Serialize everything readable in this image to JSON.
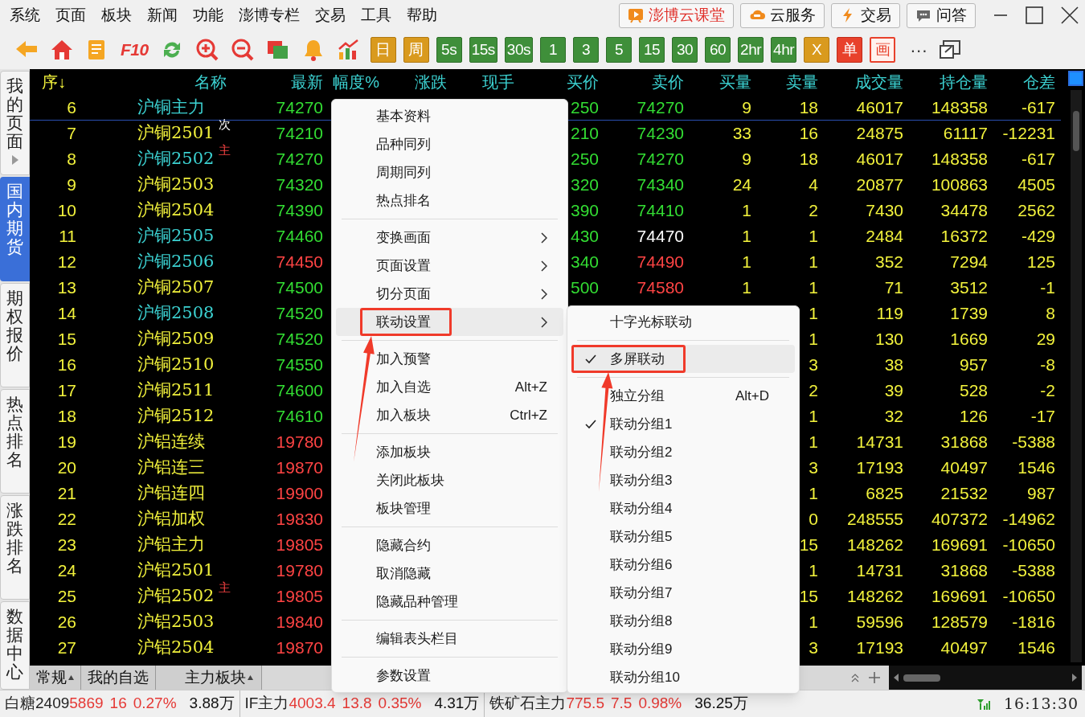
{
  "menu_bar": [
    "系统",
    "页面",
    "板块",
    "新闻",
    "功能",
    "澎博专栏",
    "交易",
    "工具",
    "帮助"
  ],
  "top_buttons": [
    {
      "label": "澎博云课堂",
      "kind": "course"
    },
    {
      "label": "云服务",
      "kind": "cloud"
    },
    {
      "label": "交易",
      "kind": "trade"
    },
    {
      "label": "问答",
      "kind": "qa"
    }
  ],
  "toolbar": {
    "f10_label": "F10",
    "period_buttons": [
      {
        "label": "日",
        "kind": "orange"
      },
      {
        "label": "周",
        "kind": "orange"
      },
      {
        "label": "5s",
        "kind": "green"
      },
      {
        "label": "15s",
        "kind": "green"
      },
      {
        "label": "30s",
        "kind": "green"
      },
      {
        "label": "1",
        "kind": "green"
      },
      {
        "label": "3",
        "kind": "green"
      },
      {
        "label": "5",
        "kind": "green"
      },
      {
        "label": "15",
        "kind": "green"
      },
      {
        "label": "30",
        "kind": "green"
      },
      {
        "label": "60",
        "kind": "green"
      },
      {
        "label": "2hr",
        "kind": "green"
      },
      {
        "label": "4hr",
        "kind": "green"
      },
      {
        "label": "X",
        "kind": "orange"
      },
      {
        "label": "单",
        "kind": "red"
      },
      {
        "label": "画",
        "kind": "outline"
      }
    ],
    "more_label": "···"
  },
  "side_tabs": [
    {
      "label": "我的页面",
      "selected": false,
      "arrow": true
    },
    {
      "label": "国内期货",
      "selected": true,
      "arrow": false
    },
    {
      "label": "期权报价",
      "selected": false,
      "arrow": false
    },
    {
      "label": "热点排名",
      "selected": false,
      "arrow": false
    },
    {
      "label": "涨跌排名",
      "selected": false,
      "arrow": false
    },
    {
      "label": "数据中心",
      "selected": false,
      "arrow": false
    }
  ],
  "table": {
    "columns": [
      "序↓",
      "名称",
      "最新",
      "幅度%",
      "涨跌",
      "现手",
      "买价",
      "卖价",
      "买量",
      "卖量",
      "成交量",
      "持仓量",
      "仓差"
    ],
    "rows": [
      {
        "seq": "6",
        "name": {
          "text": "沪铜主力",
          "color": "#3cd2d2"
        },
        "last": {
          "text": "74270",
          "color": "#33dd33"
        },
        "bid": {
          "text": "250",
          "color": "#33dd33"
        },
        "ask": {
          "text": "74270",
          "color": "#33dd33"
        },
        "bid_vol": "9",
        "ask_vol": "18",
        "volume": "46017",
        "open_interest": "148358",
        "oi_change": "-617"
      },
      {
        "seq": "7",
        "name": {
          "text": "沪铜2501",
          "color": "#f2f23c"
        },
        "tag": {
          "text": "次",
          "color": "#ffffff"
        },
        "last": {
          "text": "74210",
          "color": "#33dd33"
        },
        "bid": {
          "text": "210",
          "color": "#33dd33"
        },
        "ask": {
          "text": "74230",
          "color": "#33dd33"
        },
        "bid_vol": "33",
        "ask_vol": "16",
        "volume": "24875",
        "open_interest": "61117",
        "oi_change": "-12231"
      },
      {
        "seq": "8",
        "name": {
          "text": "沪铜2502",
          "color": "#3cd2d2"
        },
        "tag": {
          "text": "主",
          "color": "#ff4444"
        },
        "last": {
          "text": "74270",
          "color": "#33dd33"
        },
        "bid": {
          "text": "250",
          "color": "#33dd33"
        },
        "ask": {
          "text": "74270",
          "color": "#33dd33"
        },
        "bid_vol": "9",
        "ask_vol": "18",
        "volume": "46017",
        "open_interest": "148358",
        "oi_change": "-617"
      },
      {
        "seq": "9",
        "name": {
          "text": "沪铜2503",
          "color": "#f2f23c"
        },
        "last": {
          "text": "74320",
          "color": "#33dd33"
        },
        "bid": {
          "text": "320",
          "color": "#33dd33"
        },
        "ask": {
          "text": "74340",
          "color": "#33dd33"
        },
        "bid_vol": "24",
        "ask_vol": "4",
        "volume": "20877",
        "open_interest": "100863",
        "oi_change": "4505"
      },
      {
        "seq": "10",
        "name": {
          "text": "沪铜2504",
          "color": "#f2f23c"
        },
        "last": {
          "text": "74390",
          "color": "#33dd33"
        },
        "bid": {
          "text": "390",
          "color": "#33dd33"
        },
        "ask": {
          "text": "74410",
          "color": "#33dd33"
        },
        "bid_vol": "1",
        "ask_vol": "2",
        "volume": "7430",
        "open_interest": "34478",
        "oi_change": "2562"
      },
      {
        "seq": "11",
        "name": {
          "text": "沪铜2505",
          "color": "#3cd2d2"
        },
        "last": {
          "text": "74460",
          "color": "#33dd33"
        },
        "bid": {
          "text": "430",
          "color": "#33dd33"
        },
        "ask": {
          "text": "74470",
          "color": "#ffffff"
        },
        "bid_vol": "1",
        "ask_vol": "1",
        "volume": "2484",
        "open_interest": "16372",
        "oi_change": "-429"
      },
      {
        "seq": "12",
        "name": {
          "text": "沪铜2506",
          "color": "#3cd2d2"
        },
        "last": {
          "text": "74450",
          "color": "#ff4444"
        },
        "bid": {
          "text": "340",
          "color": "#33dd33"
        },
        "ask": {
          "text": "74490",
          "color": "#ff4444"
        },
        "bid_vol": "1",
        "ask_vol": "1",
        "volume": "352",
        "open_interest": "7294",
        "oi_change": "125"
      },
      {
        "seq": "13",
        "name": {
          "text": "沪铜2507",
          "color": "#f2f23c"
        },
        "last": {
          "text": "74500",
          "color": "#33dd33"
        },
        "bid": {
          "text": "500",
          "color": "#33dd33"
        },
        "ask": {
          "text": "74580",
          "color": "#ff4444"
        },
        "bid_vol": "1",
        "ask_vol": "1",
        "volume": "71",
        "open_interest": "3512",
        "oi_change": "-1"
      },
      {
        "seq": "14",
        "name": {
          "text": "沪铜2508",
          "color": "#3cd2d2"
        },
        "last": {
          "text": "74520",
          "color": "#33dd33"
        },
        "ask_vol": "1",
        "volume": "119",
        "open_interest": "1739",
        "oi_change": "8"
      },
      {
        "seq": "15",
        "name": {
          "text": "沪铜2509",
          "color": "#f2f23c"
        },
        "last": {
          "text": "74520",
          "color": "#33dd33"
        },
        "ask_vol": "1",
        "volume": "130",
        "open_interest": "1669",
        "oi_change": "29"
      },
      {
        "seq": "16",
        "name": {
          "text": "沪铜2510",
          "color": "#f2f23c"
        },
        "last": {
          "text": "74550",
          "color": "#33dd33"
        },
        "ask_vol": "3",
        "volume": "38",
        "open_interest": "957",
        "oi_change": "-8"
      },
      {
        "seq": "17",
        "name": {
          "text": "沪铜2511",
          "color": "#f2f23c"
        },
        "last": {
          "text": "74600",
          "color": "#33dd33"
        },
        "ask_vol": "2",
        "volume": "39",
        "open_interest": "528",
        "oi_change": "-2"
      },
      {
        "seq": "18",
        "name": {
          "text": "沪铜2512",
          "color": "#f2f23c"
        },
        "last": {
          "text": "74610",
          "color": "#33dd33"
        },
        "ask_vol": "1",
        "volume": "32",
        "open_interest": "126",
        "oi_change": "-17"
      },
      {
        "seq": "19",
        "name": {
          "text": "沪铝连续",
          "color": "#f2f23c"
        },
        "last": {
          "text": "19780",
          "color": "#ff4444"
        },
        "ask_vol": "1",
        "volume": "14731",
        "open_interest": "31868",
        "oi_change": "-5388"
      },
      {
        "seq": "20",
        "name": {
          "text": "沪铝连三",
          "color": "#f2f23c"
        },
        "last": {
          "text": "19870",
          "color": "#ff4444"
        },
        "ask_vol": "3",
        "volume": "17193",
        "open_interest": "40497",
        "oi_change": "1546"
      },
      {
        "seq": "21",
        "name": {
          "text": "沪铝连四",
          "color": "#f2f23c"
        },
        "last": {
          "text": "19900",
          "color": "#ff4444"
        },
        "ask_vol": "1",
        "volume": "6825",
        "open_interest": "21532",
        "oi_change": "987"
      },
      {
        "seq": "22",
        "name": {
          "text": "沪铝加权",
          "color": "#f2f23c"
        },
        "last": {
          "text": "19830",
          "color": "#ff4444"
        },
        "ask_vol": "0",
        "volume": "248555",
        "open_interest": "407372",
        "oi_change": "-14962"
      },
      {
        "seq": "23",
        "name": {
          "text": "沪铝主力",
          "color": "#f2f23c"
        },
        "last": {
          "text": "19805",
          "color": "#ff4444"
        },
        "ask_vol": "15",
        "volume": "148262",
        "open_interest": "169691",
        "oi_change": "-10650"
      },
      {
        "seq": "24",
        "name": {
          "text": "沪铝2501",
          "color": "#f2f23c"
        },
        "last": {
          "text": "19780",
          "color": "#ff4444"
        },
        "ask_vol": "1",
        "volume": "14731",
        "open_interest": "31868",
        "oi_change": "-5388"
      },
      {
        "seq": "25",
        "name": {
          "text": "沪铝2502",
          "color": "#f2f23c"
        },
        "tag": {
          "text": "主",
          "color": "#ff4444"
        },
        "last": {
          "text": "19805",
          "color": "#ff4444"
        },
        "ask_vol": "15",
        "volume": "148262",
        "open_interest": "169691",
        "oi_change": "-10650"
      },
      {
        "seq": "26",
        "name": {
          "text": "沪铝2503",
          "color": "#f2f23c"
        },
        "last": {
          "text": "19840",
          "color": "#ff4444"
        },
        "ask_vol": "1",
        "volume": "59596",
        "open_interest": "128579",
        "oi_change": "-1816"
      },
      {
        "seq": "27",
        "name": {
          "text": "沪铝2504",
          "color": "#f2f23c"
        },
        "last": {
          "text": "19870",
          "color": "#ff4444"
        },
        "ask_vol": "3",
        "volume": "17193",
        "open_interest": "40497",
        "oi_change": "1546"
      }
    ]
  },
  "context_menu": [
    {
      "kind": "item",
      "label": "基本资料",
      "submenu": false,
      "selected": false,
      "annotated": false
    },
    {
      "kind": "item",
      "label": "品种同列",
      "submenu": false,
      "selected": false,
      "annotated": false
    },
    {
      "kind": "item",
      "label": "周期同列",
      "submenu": false,
      "selected": false,
      "annotated": false
    },
    {
      "kind": "item",
      "label": "热点排名",
      "submenu": false,
      "selected": false,
      "annotated": false
    },
    {
      "kind": "separator"
    },
    {
      "kind": "item",
      "label": "变换画面",
      "submenu": true,
      "selected": false,
      "annotated": false
    },
    {
      "kind": "item",
      "label": "页面设置",
      "submenu": true,
      "selected": false,
      "annotated": false
    },
    {
      "kind": "item",
      "label": "切分页面",
      "submenu": true,
      "selected": false,
      "annotated": false
    },
    {
      "kind": "item",
      "label": "联动设置",
      "submenu": true,
      "selected": true,
      "annotated": true
    },
    {
      "kind": "separator"
    },
    {
      "kind": "item",
      "label": "加入预警",
      "submenu": false,
      "selected": false,
      "annotated": false
    },
    {
      "kind": "item",
      "label": "加入自选",
      "shortcut": "Alt+Z",
      "submenu": false,
      "selected": false,
      "annotated": false
    },
    {
      "kind": "item",
      "label": "加入板块",
      "shortcut": "Ctrl+Z",
      "submenu": false,
      "selected": false,
      "annotated": false
    },
    {
      "kind": "separator"
    },
    {
      "kind": "item",
      "label": "添加板块",
      "submenu": false,
      "selected": false,
      "annotated": false
    },
    {
      "kind": "item",
      "label": "关闭此板块",
      "submenu": false,
      "selected": false,
      "annotated": false
    },
    {
      "kind": "item",
      "label": "板块管理",
      "submenu": false,
      "selected": false,
      "annotated": false
    },
    {
      "kind": "separator"
    },
    {
      "kind": "item",
      "label": "隐藏合约",
      "submenu": false,
      "selected": false,
      "annotated": false
    },
    {
      "kind": "item",
      "label": "取消隐藏",
      "submenu": false,
      "selected": false,
      "annotated": false
    },
    {
      "kind": "item",
      "label": "隐藏品种管理",
      "submenu": false,
      "selected": false,
      "annotated": false
    },
    {
      "kind": "separator"
    },
    {
      "kind": "item",
      "label": "编辑表头栏目",
      "submenu": false,
      "selected": false,
      "annotated": false
    },
    {
      "kind": "separator"
    },
    {
      "kind": "item",
      "label": "参数设置",
      "submenu": false,
      "selected": false,
      "annotated": false
    }
  ],
  "submenu": [
    {
      "kind": "item",
      "label": "十字光标联动",
      "checked": false,
      "selected": false,
      "annotated": false
    },
    {
      "kind": "separator"
    },
    {
      "kind": "item",
      "label": "多屏联动",
      "checked": true,
      "selected": true,
      "annotated": true
    },
    {
      "kind": "separator"
    },
    {
      "kind": "item",
      "label": "独立分组",
      "shortcut": "Alt+D",
      "checked": false,
      "selected": false,
      "annotated": false
    },
    {
      "kind": "item",
      "label": "联动分组1",
      "checked": true,
      "selected": false,
      "annotated": false
    },
    {
      "kind": "item",
      "label": "联动分组2",
      "checked": false,
      "selected": false,
      "annotated": false
    },
    {
      "kind": "item",
      "label": "联动分组3",
      "checked": false,
      "selected": false,
      "annotated": false
    },
    {
      "kind": "item",
      "label": "联动分组4",
      "checked": false,
      "selected": false,
      "annotated": false
    },
    {
      "kind": "item",
      "label": "联动分组5",
      "checked": false,
      "selected": false,
      "annotated": false
    },
    {
      "kind": "item",
      "label": "联动分组6",
      "checked": false,
      "selected": false,
      "annotated": false
    },
    {
      "kind": "item",
      "label": "联动分组7",
      "checked": false,
      "selected": false,
      "annotated": false
    },
    {
      "kind": "item",
      "label": "联动分组8",
      "checked": false,
      "selected": false,
      "annotated": false
    },
    {
      "kind": "item",
      "label": "联动分组9",
      "checked": false,
      "selected": false,
      "annotated": false
    },
    {
      "kind": "item",
      "label": "联动分组10",
      "checked": false,
      "selected": false,
      "annotated": false
    }
  ],
  "bottom_tabs": [
    {
      "label": "常规",
      "dropdown": true
    },
    {
      "label": "我的自选",
      "dropdown": false
    },
    {
      "label": "主力板块",
      "dropdown": true
    }
  ],
  "status_bar": {
    "quotes": [
      {
        "name": "白糖2409",
        "price": "5869",
        "change": "16",
        "pct": "0.27%",
        "amount": "3.88万",
        "up": true
      },
      {
        "name": "IF主力",
        "price": "4003.4",
        "change": "13.8",
        "pct": "0.35%",
        "amount": "4.31万",
        "up": true
      },
      {
        "name": "铁矿石主力",
        "price": "775.5",
        "change": "7.5",
        "pct": "0.98%",
        "amount": "36.25万",
        "up": true
      }
    ],
    "time": "16:13:30"
  }
}
